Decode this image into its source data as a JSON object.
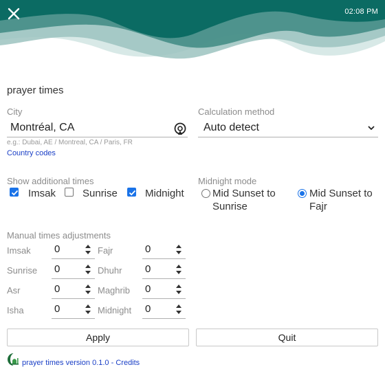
{
  "header": {
    "time": "02:08 PM",
    "colors": {
      "primary": "#0b6b63",
      "mid": "#3e8a83",
      "light": "#9cc3bf",
      "pale": "#d8e9e7"
    }
  },
  "app_title": "prayer times",
  "city": {
    "label": "City",
    "value": "Montréal, CA",
    "hint": "e.g.: Dubai, AE / Montreal, CA / Paris, FR",
    "country_codes_link": "Country codes"
  },
  "calculation": {
    "label": "Calculation method",
    "selected": "Auto detect"
  },
  "additional_times": {
    "label": "Show additional times",
    "items": [
      {
        "label": "Imsak",
        "checked": true
      },
      {
        "label": "Sunrise",
        "checked": false
      },
      {
        "label": "Midnight",
        "checked": true
      }
    ]
  },
  "midnight_mode": {
    "label": "Midnight mode",
    "options": [
      {
        "label": "Mid Sunset to Sunrise",
        "selected": false
      },
      {
        "label": "Mid Sunset to Fajr",
        "selected": true
      }
    ]
  },
  "adjustments": {
    "label": "Manual times adjustments",
    "rows": [
      {
        "left": {
          "name": "Imsak",
          "value": "0"
        },
        "right": {
          "name": "Fajr",
          "value": "0"
        }
      },
      {
        "left": {
          "name": "Sunrise",
          "value": "0"
        },
        "right": {
          "name": "Dhuhr",
          "value": "0"
        }
      },
      {
        "left": {
          "name": "Asr",
          "value": "0"
        },
        "right": {
          "name": "Maghrib",
          "value": "0"
        }
      },
      {
        "left": {
          "name": "Isha",
          "value": "0"
        },
        "right": {
          "name": "Midnight",
          "value": "0"
        }
      }
    ]
  },
  "buttons": {
    "apply": "Apply",
    "quit": "Quit"
  },
  "footer": {
    "version_text": "prayer times version 0.1.0",
    "separator": " - ",
    "credits_link": "Credits",
    "link_color": "#1a3fc6"
  },
  "icons": [
    "close-icon",
    "location-icon",
    "chevron-down-icon",
    "checkmark-icon",
    "spinner-arrows-icon",
    "mosque-logo-icon"
  ]
}
